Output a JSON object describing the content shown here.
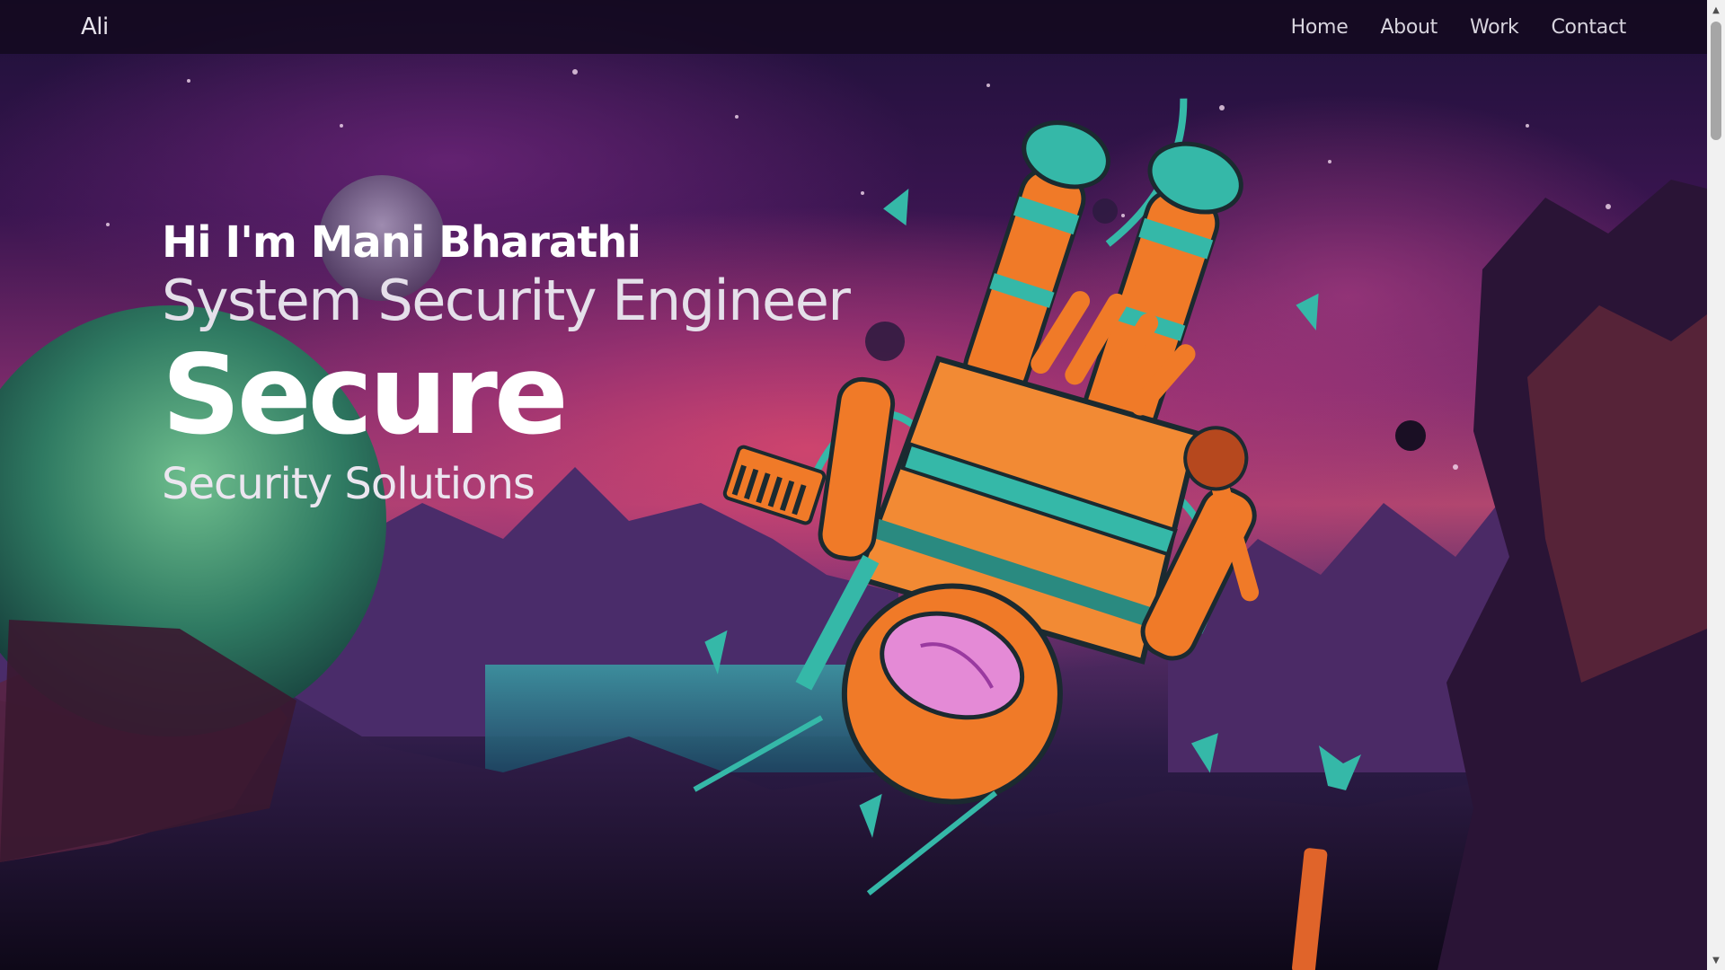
{
  "nav": {
    "brand": "Ali",
    "links": [
      {
        "label": "Home"
      },
      {
        "label": "About"
      },
      {
        "label": "Work"
      },
      {
        "label": "Contact"
      }
    ]
  },
  "hero": {
    "greeting": "Hi I'm Mani Bharathi",
    "role": "System Security Engineer",
    "headline": "Secure",
    "tagline": "Security Solutions"
  },
  "illustration": {
    "subject": "astronaut-floating-over-alien-landscape",
    "colors": {
      "sky_top": "#1d1038",
      "sky_glow": "#b1466f",
      "suit_orange": "#f07a28",
      "suit_teal": "#35b8a8",
      "planet_green": "#3c8a6a"
    }
  }
}
